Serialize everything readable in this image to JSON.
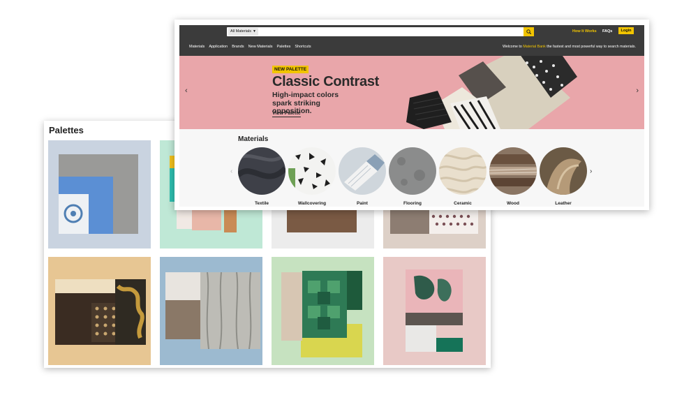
{
  "palettes": {
    "title": "Palettes",
    "tile_count": 8
  },
  "site": {
    "search": {
      "category": "All Materials",
      "placeholder": ""
    },
    "top_links": {
      "how_it_works": "How It Works",
      "faqs": "FAQs",
      "login": "Login"
    },
    "nav": [
      "Materials",
      "Application",
      "Brands",
      "New Materials",
      "Palettes",
      "Shortcuts"
    ],
    "welcome": {
      "prefix": "Welcome to",
      "brand": "Material Bank",
      "suffix": "the fastest and most powerful way to search materials."
    },
    "hero": {
      "badge": "NEW PALETTE",
      "title": "Classic Contrast",
      "subtitle": "High-impact colors spark striking opposition.",
      "link": "View Palette"
    },
    "materials": {
      "title": "Materials",
      "items": [
        "Textile",
        "Wallcovering",
        "Paint",
        "Flooring",
        "Ceramic",
        "Wood",
        "Leather"
      ]
    }
  },
  "colors": {
    "accent": "#f1c400",
    "topbar": "#3b3b3b",
    "hero_bg": "#e9a6aa"
  },
  "icons": {
    "search": "search-icon",
    "dropdown": "chevron-down-icon",
    "prev": "chevron-left-icon",
    "next": "chevron-right-icon"
  }
}
